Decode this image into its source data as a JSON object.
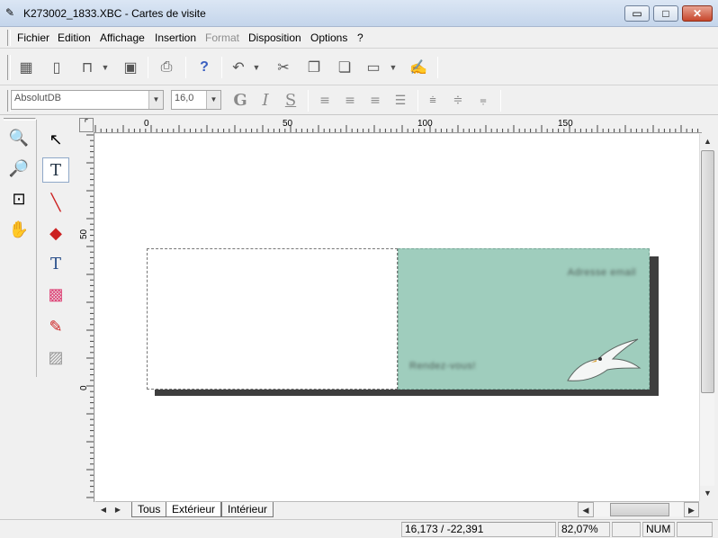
{
  "window": {
    "title": "K273002_1833.XBC - Cartes de visite",
    "minimize": "▭",
    "maximize": "□",
    "close": "✕"
  },
  "menu": [
    {
      "label": "Fichier",
      "enabled": true
    },
    {
      "label": "Edition",
      "enabled": true
    },
    {
      "label": "Affichage",
      "enabled": true
    },
    {
      "label": "Insertion",
      "enabled": true
    },
    {
      "label": "Format",
      "enabled": false
    },
    {
      "label": "Disposition",
      "enabled": true
    },
    {
      "label": "Options",
      "enabled": true
    },
    {
      "label": "?",
      "enabled": true
    }
  ],
  "toolbar": {
    "font_name": "AbsolutDB",
    "font_size": "16,0",
    "bold_label": "G",
    "italic_label": "I",
    "underline_label": "S"
  },
  "ruler": {
    "h_labels": [
      "0",
      "50",
      "100",
      "150"
    ],
    "v_labels": [
      "50",
      "0"
    ]
  },
  "card": {
    "line1": "Adresse email",
    "line2": "Rendez-vous!"
  },
  "tabs": [
    "Tous",
    "Extérieur",
    "Intérieur"
  ],
  "active_tab": "Extérieur",
  "status": {
    "coords": "16,173 / -22,391",
    "zoom": "82,07%",
    "num": "NUM"
  },
  "colors": {
    "card_right": "#9fcdbd",
    "shadow": "#3e3e3e"
  }
}
